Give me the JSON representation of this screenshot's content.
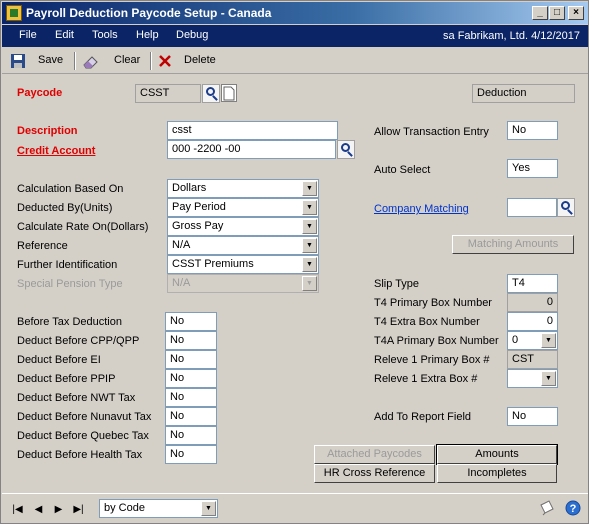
{
  "window": {
    "title": "Payroll Deduction Paycode Setup - Canada",
    "min_glyph": "_",
    "max_glyph": "□",
    "close_glyph": "×"
  },
  "menu": {
    "items": [
      "File",
      "Edit",
      "Tools",
      "Help",
      "Debug"
    ],
    "info": "sa  Fabrikam, Ltd.  4/12/2017"
  },
  "toolbar": {
    "save": "Save",
    "clear": "Clear",
    "delete": "Delete"
  },
  "header": {
    "paycode_label": "Paycode",
    "paycode_value": "CSST",
    "type_value": "Deduction"
  },
  "left": {
    "description_label": "Description",
    "description_value": "csst",
    "credit_account_label": "Credit Account",
    "credit_account_value": "000 -2200 -00",
    "dropdowns": [
      {
        "label": "Calculation Based On",
        "value": "Dollars"
      },
      {
        "label": "Deducted By(Units)",
        "value": "Pay Period"
      },
      {
        "label": "Calculate Rate On(Dollars)",
        "value": "Gross Pay"
      },
      {
        "label": "Reference",
        "value": "N/A"
      },
      {
        "label": "Further Identification",
        "value": "CSST Premiums"
      },
      {
        "label": "Special Pension Type",
        "value": "N/A"
      }
    ],
    "deduct_rows": [
      {
        "label": "Before Tax Deduction",
        "value": "No"
      },
      {
        "label": "Deduct Before CPP/QPP",
        "value": "No"
      },
      {
        "label": "Deduct Before EI",
        "value": "No"
      },
      {
        "label": "Deduct Before PPIP",
        "value": "No"
      },
      {
        "label": "Deduct Before NWT Tax",
        "value": "No"
      },
      {
        "label": "Deduct Before Nunavut Tax",
        "value": "No"
      },
      {
        "label": "Deduct Before Quebec Tax",
        "value": "No"
      },
      {
        "label": "Deduct Before Health Tax",
        "value": "No"
      }
    ]
  },
  "right": {
    "allow_transaction_entry_label": "Allow Transaction Entry",
    "allow_transaction_entry_value": "No",
    "auto_select_label": "Auto Select",
    "auto_select_value": "Yes",
    "company_matching_label": "Company Matching",
    "company_matching_value": "",
    "matching_amounts_button": "Matching Amounts",
    "slip_type_label": "Slip Type",
    "slip_type_value": "T4",
    "t4_primary_label": "T4 Primary Box Number",
    "t4_primary_value": "0",
    "t4_extra_label": "T4 Extra Box Number",
    "t4_extra_value": "0",
    "t4a_primary_label": "T4A Primary Box Number",
    "t4a_primary_value": "0",
    "releve1_primary_label": "Releve 1 Primary Box #",
    "releve1_primary_value": "CST",
    "releve1_extra_label": "Releve 1 Extra Box #",
    "releve1_extra_value": "",
    "add_to_report_label": "Add To Report Field",
    "add_to_report_value": "No"
  },
  "buttons": {
    "attached_paycodes": "Attached Paycodes",
    "amounts": "Amounts",
    "hr_cross_reference": "HR Cross Reference",
    "incompletes": "Incompletes"
  },
  "status": {
    "sort_value": "by Code"
  },
  "colors": {
    "required": "#e00000",
    "link": "#0033cc",
    "menubar": "#0b2466"
  }
}
